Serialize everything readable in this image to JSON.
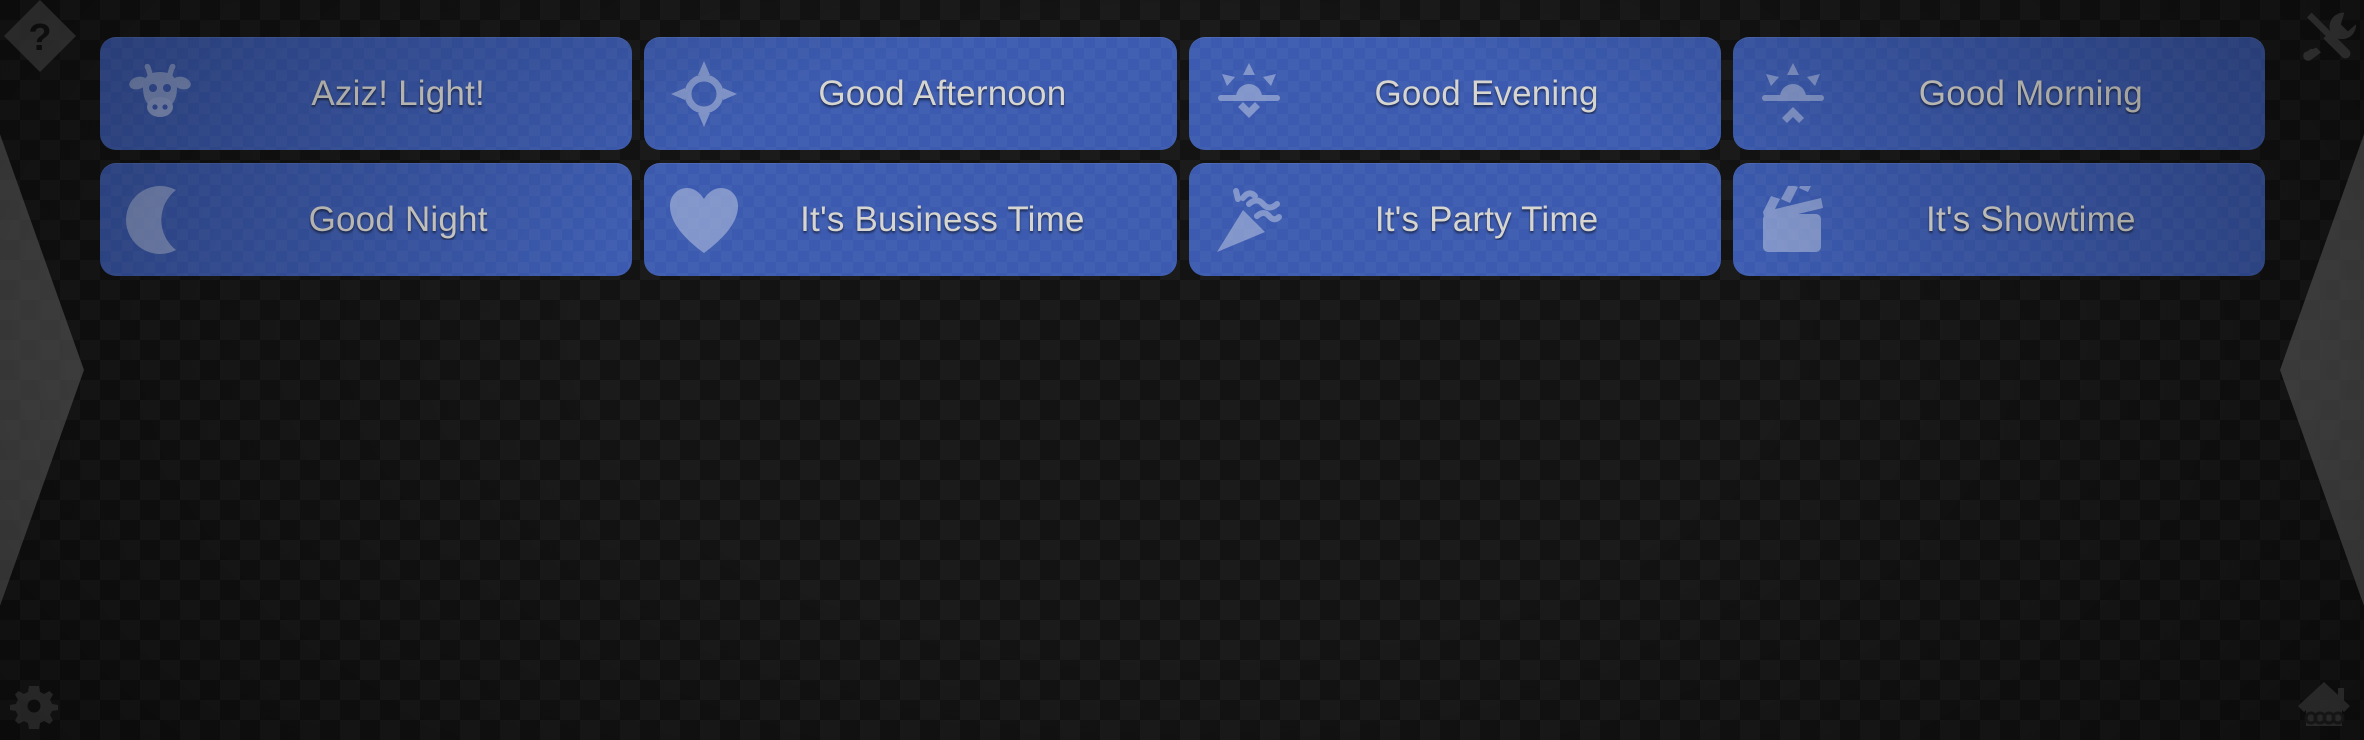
{
  "scene_buttons": [
    {
      "label": "Aziz! Light!",
      "icon": "cow-icon"
    },
    {
      "label": "Good Afternoon",
      "icon": "sun-brightness-icon"
    },
    {
      "label": "Good Evening",
      "icon": "sunset-icon"
    },
    {
      "label": "Good Morning",
      "icon": "sunrise-icon"
    },
    {
      "label": "Good Night",
      "icon": "crescent-moon-icon"
    },
    {
      "label": "It's Business Time",
      "icon": "heart-icon"
    },
    {
      "label": "It's Party Time",
      "icon": "party-popper-icon"
    },
    {
      "label": "It's Showtime",
      "icon": "clapperboard-icon"
    }
  ],
  "corners": {
    "help": "help-question-icon",
    "tools": "tools-wrench-screwdriver-icon",
    "settings": "gear-icon",
    "home": "home-icon"
  },
  "edges": {
    "prev": "chevron-left-page-icon",
    "next": "chevron-right-page-icon"
  },
  "colors": {
    "tile_blue": "#3c5bb0",
    "tile_label": "#d7d5cf",
    "background": "#131313",
    "icon_tint": "#aebbdd"
  }
}
